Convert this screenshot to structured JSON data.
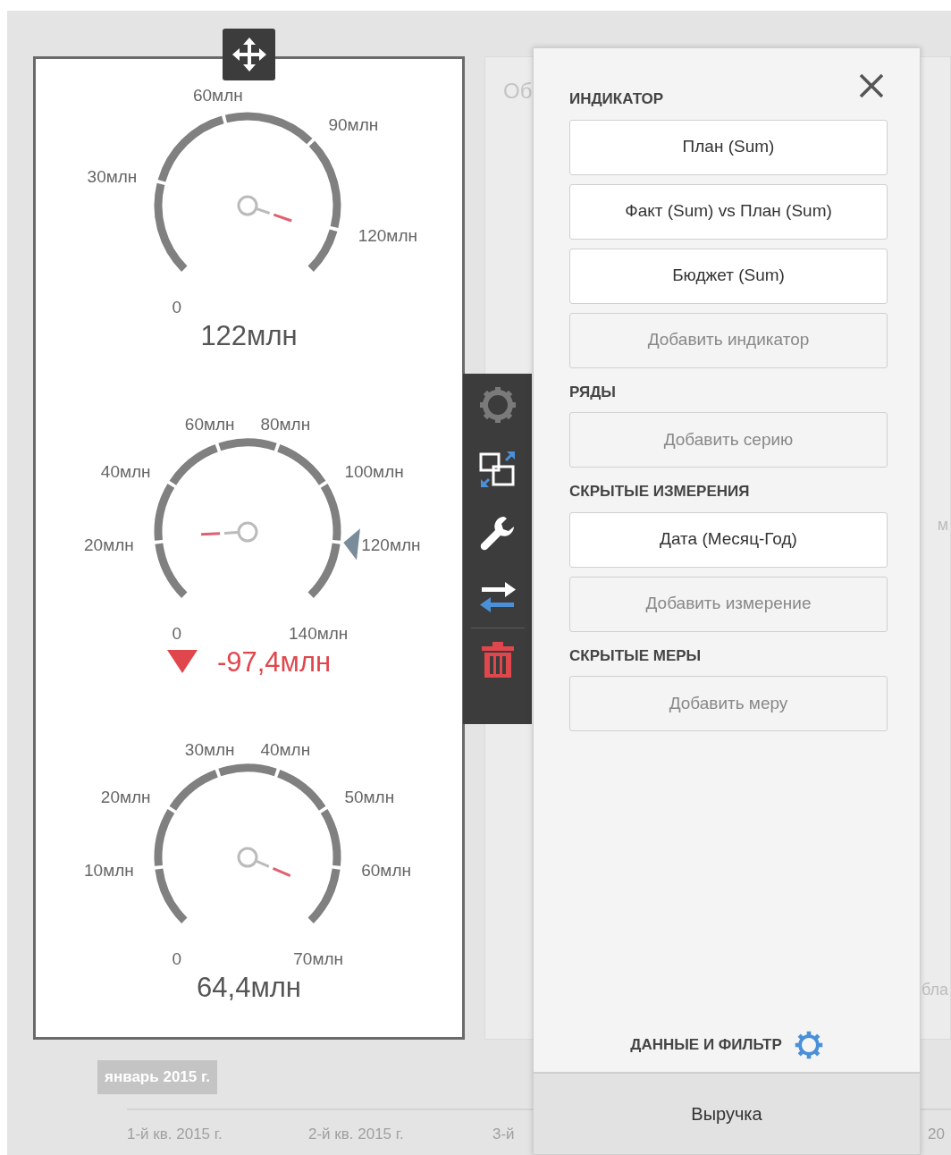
{
  "gauges": [
    {
      "ticks": [
        "0",
        "30млн",
        "60млн",
        "90млн",
        "120млн"
      ],
      "value": "122млн",
      "down": false
    },
    {
      "ticks": [
        "0",
        "20млн",
        "40млн",
        "60млн",
        "80млн",
        "100млн",
        "120млн",
        "140млн"
      ],
      "has_target": true,
      "value": "-97,4млн",
      "down": true
    },
    {
      "ticks": [
        "0",
        "10млн",
        "20млн",
        "30млн",
        "40млн",
        "50млн",
        "60млн",
        "70млн"
      ],
      "value": "64,4млн",
      "down": false
    }
  ],
  "background_card": {
    "title": "Об",
    "edge_texts": [
      "м",
      "бла"
    ]
  },
  "timeline": {
    "selection_label": "январь 2015 г.",
    "axis_labels": [
      "1-й кв. 2015 г.",
      "2-й кв. 2015 г.",
      "3-й",
      "20"
    ]
  },
  "panel": {
    "sections": [
      {
        "heading": "ИНДИКАТОР",
        "items": [
          {
            "label": "План (Sum)",
            "kind": "field"
          },
          {
            "label": "Факт (Sum) vs План (Sum)",
            "kind": "field"
          },
          {
            "label": "Бюджет (Sum)",
            "kind": "field"
          },
          {
            "label": "Добавить индикатор",
            "kind": "add"
          }
        ]
      },
      {
        "heading": "РЯДЫ",
        "items": [
          {
            "label": "Добавить серию",
            "kind": "add"
          }
        ]
      },
      {
        "heading": "СКРЫТЫЕ ИЗМЕРЕНИЯ",
        "items": [
          {
            "label": "Дата (Месяц-Год)",
            "kind": "field"
          },
          {
            "label": "Добавить измерение",
            "kind": "add"
          }
        ]
      },
      {
        "heading": "СКРЫТЫЕ МЕРЫ",
        "items": [
          {
            "label": "Добавить меру",
            "kind": "add"
          }
        ]
      }
    ],
    "footer_link": "ДАННЫЕ И ФИЛЬТР",
    "footer_tab": "Выручка"
  }
}
